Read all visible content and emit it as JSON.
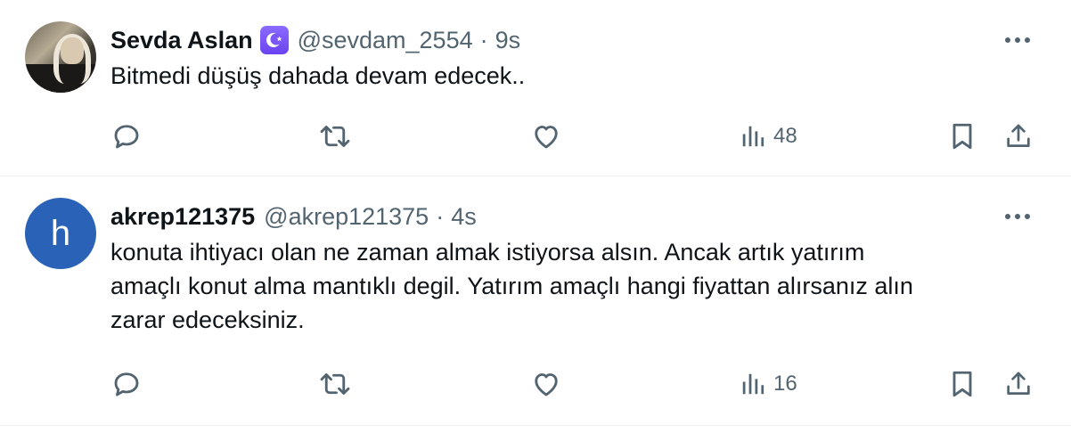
{
  "tweets": [
    {
      "name": "Sevda Aslan",
      "verified_badge": "crescent-star-badge",
      "handle": "@sevdam_2554",
      "separator": "·",
      "time": "9s",
      "text": "Bitmedi düşüş dahada devam edecek..",
      "avatar": "photo",
      "views": "48"
    },
    {
      "name": "akrep121375",
      "handle": "@akrep121375",
      "separator": "·",
      "time": "4s",
      "text": "konuta ihtiyacı olan ne zaman almak istiyorsa alsın. Ancak artık yatırım\namaçlı konut alma mantıklı degil. Yatırım amaçlı hangi fiyattan alırsanız alın\nzarar edeceksiniz.",
      "avatar_letter": "h",
      "avatar_color": "#2a62b8",
      "views": "16"
    }
  ],
  "colors": {
    "text_primary": "#0f1419",
    "text_secondary": "#536471",
    "border": "#eff3f4",
    "badge": "#7856ff"
  },
  "icons": [
    "reply-icon",
    "retweet-icon",
    "like-icon",
    "views-icon",
    "bookmark-icon",
    "share-icon",
    "more-icon"
  ]
}
